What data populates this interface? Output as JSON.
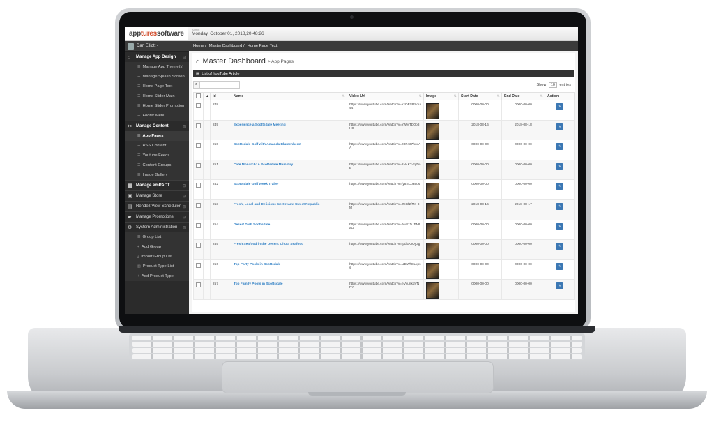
{
  "header": {
    "logo_prefix": "app",
    "logo_accent": "tures",
    "logo_suffix": "software",
    "session_label": "Admin",
    "datetime": "Monday, October 01, 2018,20:48:26"
  },
  "user": {
    "name": "Dan Elliott -"
  },
  "sidebar": {
    "sections": [
      {
        "label": "Manage App Design",
        "items": [
          "Manage App Theme(s)",
          "Manage Splash Screen",
          "Home Page Text",
          "Home Slider Main",
          "Home Slider Promotion",
          "Footer Menu"
        ]
      },
      {
        "label": "Manage Content",
        "items": [
          "App Pages",
          "RSS Content",
          "Youtube Feeds",
          "Content Groups",
          "Image Gallery"
        ]
      },
      {
        "label": "Manage emPACT",
        "items": []
      },
      {
        "label": "Manage Store",
        "items": []
      },
      {
        "label": "Rendez View Scheduler",
        "items": []
      },
      {
        "label": "Manage Promotions",
        "items": []
      },
      {
        "label": "System Administration",
        "items": [
          "Group List",
          "Add Group",
          "Import Group List",
          "Product Type List",
          "Add Product Type"
        ]
      }
    ]
  },
  "breadcrumb": [
    "Home /",
    "Master Dashboard /",
    "Home Page Text"
  ],
  "page": {
    "title": "Master Dashboard",
    "subtitle": "> App Pages",
    "panel_title": "List of YouTube Article",
    "show_label": "Show",
    "show_value": "10",
    "entries_label": "entries"
  },
  "table": {
    "columns": [
      "Id",
      "Name",
      "Video Url",
      "Image",
      "Start Date",
      "End Date",
      "Action"
    ],
    "rows": [
      {
        "id": "248",
        "name": "",
        "url": "https://www.youtube.com/watch?v=xxOESPSoui44",
        "start": "0000-00-00",
        "end": "0000-00-00"
      },
      {
        "id": "249",
        "name": "Experience a Scottsdale Meeting",
        "url": "https://www.youtube.com/watch?v=xWMTD0p8H0",
        "start": "2018-08-16",
        "end": "2018-08-18"
      },
      {
        "id": "250",
        "name": "Scottsdale Golf with Amanda Blumenherst",
        "url": "https://www.youtube.com/watch?v=00F437hoxAA",
        "start": "0000-00-00",
        "end": "0000-00-00"
      },
      {
        "id": "251",
        "name": "Café Monarch: A Scottsdale Mainstay",
        "url": "https://www.youtube.com/watch?v=zN4KT-FyDaE",
        "start": "0000-00-00",
        "end": "0000-00-00"
      },
      {
        "id": "252",
        "name": "Scottsdale Golf Week Trailer",
        "url": "https://www.youtube.com/watch?v=fy8SCbaeus",
        "start": "0000-00-00",
        "end": "0000-00-00"
      },
      {
        "id": "253",
        "name": "Fresh, Local and Delicious Ice Cream: Sweet Republic",
        "url": "https://www.youtube.com/watch?v=ZcGf2fMn-8M",
        "start": "2018-08-16",
        "end": "2018-08-17"
      },
      {
        "id": "254",
        "name": "Desert Dish Scottsdale",
        "url": "https://www.youtube.com/watch?v=AHzz1uJW8aQ",
        "start": "0000-00-00",
        "end": "0000-00-00"
      },
      {
        "id": "255",
        "name": "Fresh Seafood in the Desert: Chula Seafood",
        "url": "https://www.youtube.com/watch?v=IpdpAJOy3g",
        "start": "0000-00-00",
        "end": "0000-00-00"
      },
      {
        "id": "256",
        "name": "Top Party Pools in Scottsdale",
        "url": "https://www.youtube.com/watch?v=UDWhBLxpss",
        "start": "0000-00-00",
        "end": "0000-00-00"
      },
      {
        "id": "257",
        "name": "Top Family Pools in Scottsdale",
        "url": "https://www.youtube.com/watch?v=eVyunkqVNPY",
        "start": "0000-00-00",
        "end": "0000-00-00"
      }
    ]
  },
  "colors": {
    "accent": "#3c78b4",
    "link": "#2f7fc4",
    "sidebar": "#2b2b2b",
    "logo_accent": "#d14b2a"
  }
}
